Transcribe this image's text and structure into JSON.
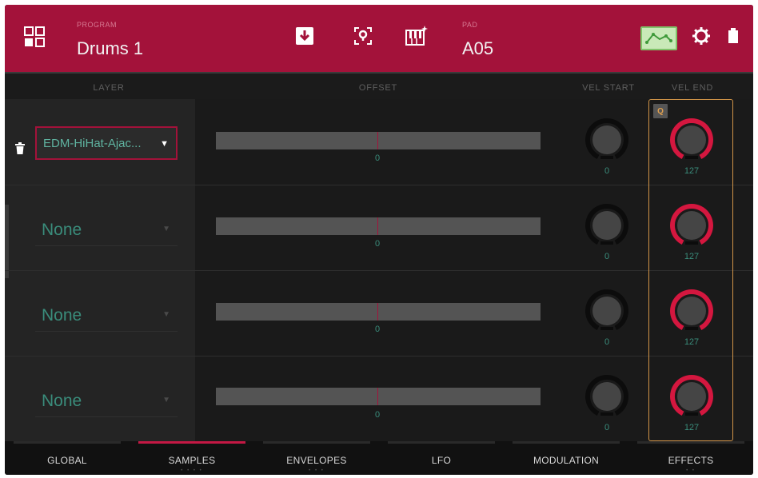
{
  "header": {
    "program_label": "PROGRAM",
    "program_name": "Drums 1",
    "pad_label": "PAD",
    "pad_name": "A05",
    "icons": [
      "grid-icon",
      "download-icon",
      "target-icon",
      "keyboard-icon",
      "waveform-icon",
      "gear-icon",
      "battery-icon"
    ]
  },
  "columns": {
    "layer": "LAYER",
    "offset": "OFFSET",
    "vel_start": "VEL START",
    "vel_end": "VEL END"
  },
  "layers": [
    {
      "sample": "EDM-HiHat-Ajac...",
      "offset": "0",
      "vel_start": "0",
      "vel_end": "127",
      "selected": true
    },
    {
      "sample": "None",
      "offset": "0",
      "vel_start": "0",
      "vel_end": "127",
      "selected": false
    },
    {
      "sample": "None",
      "offset": "0",
      "vel_start": "0",
      "vel_end": "127",
      "selected": false
    },
    {
      "sample": "None",
      "offset": "0",
      "vel_start": "0",
      "vel_end": "127",
      "selected": false
    }
  ],
  "q_badge": "Q",
  "tabs": [
    {
      "label": "GLOBAL",
      "active": false,
      "dots": ""
    },
    {
      "label": "SAMPLES",
      "active": true,
      "dots": "• • • •"
    },
    {
      "label": "ENVELOPES",
      "active": false,
      "dots": "• • •"
    },
    {
      "label": "LFO",
      "active": false,
      "dots": ""
    },
    {
      "label": "MODULATION",
      "active": false,
      "dots": ""
    },
    {
      "label": "EFFECTS",
      "active": false,
      "dots": "• •"
    }
  ],
  "colors": {
    "accent": "#a3123a",
    "knob_active": "#d4173f",
    "value_text": "#3a8c7b",
    "highlight_box": "#d09448"
  }
}
